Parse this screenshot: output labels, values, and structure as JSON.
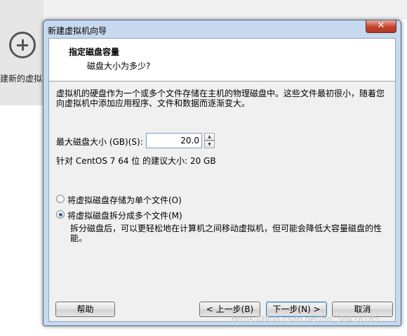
{
  "background": {
    "new_vm_label": "建新的虚拟"
  },
  "dialog": {
    "title": "新建虚拟机向导",
    "close_label": "✕",
    "header": {
      "title": "指定磁盘容量",
      "subtitle": "磁盘大小为多少?"
    },
    "description": "虚拟机的硬盘作为一个或多个文件存储在主机的物理磁盘中。这些文件最初很小，随着您向虚拟机中添加应用程序、文件和数据而逐渐变大。",
    "max_size_label": "最大磁盘大小 (GB)(S):",
    "max_size_value": "20.0",
    "recommended_text": "针对 CentOS 7 64 位 的建议大小: 20 GB",
    "options": [
      {
        "label": "将虚拟磁盘存储为单个文件(O)",
        "selected": false
      },
      {
        "label": "将虚拟磁盘拆分成多个文件(M)",
        "selected": true
      }
    ],
    "split_description": "拆分磁盘后，可以更轻松地在计算机之间移动虚拟机，但可能会降低大容量磁盘的性能。",
    "buttons": {
      "help": "帮助",
      "back": "< 上一步(B)",
      "next": "下一步(N) >",
      "cancel": "取消"
    }
  },
  "watermark": "https://blog.csdn.net/qq_38418185",
  "colors": {
    "title_bar": "#c6d9ee",
    "close_button": "#c5412b",
    "radio_selected": "#1f5fa8"
  }
}
